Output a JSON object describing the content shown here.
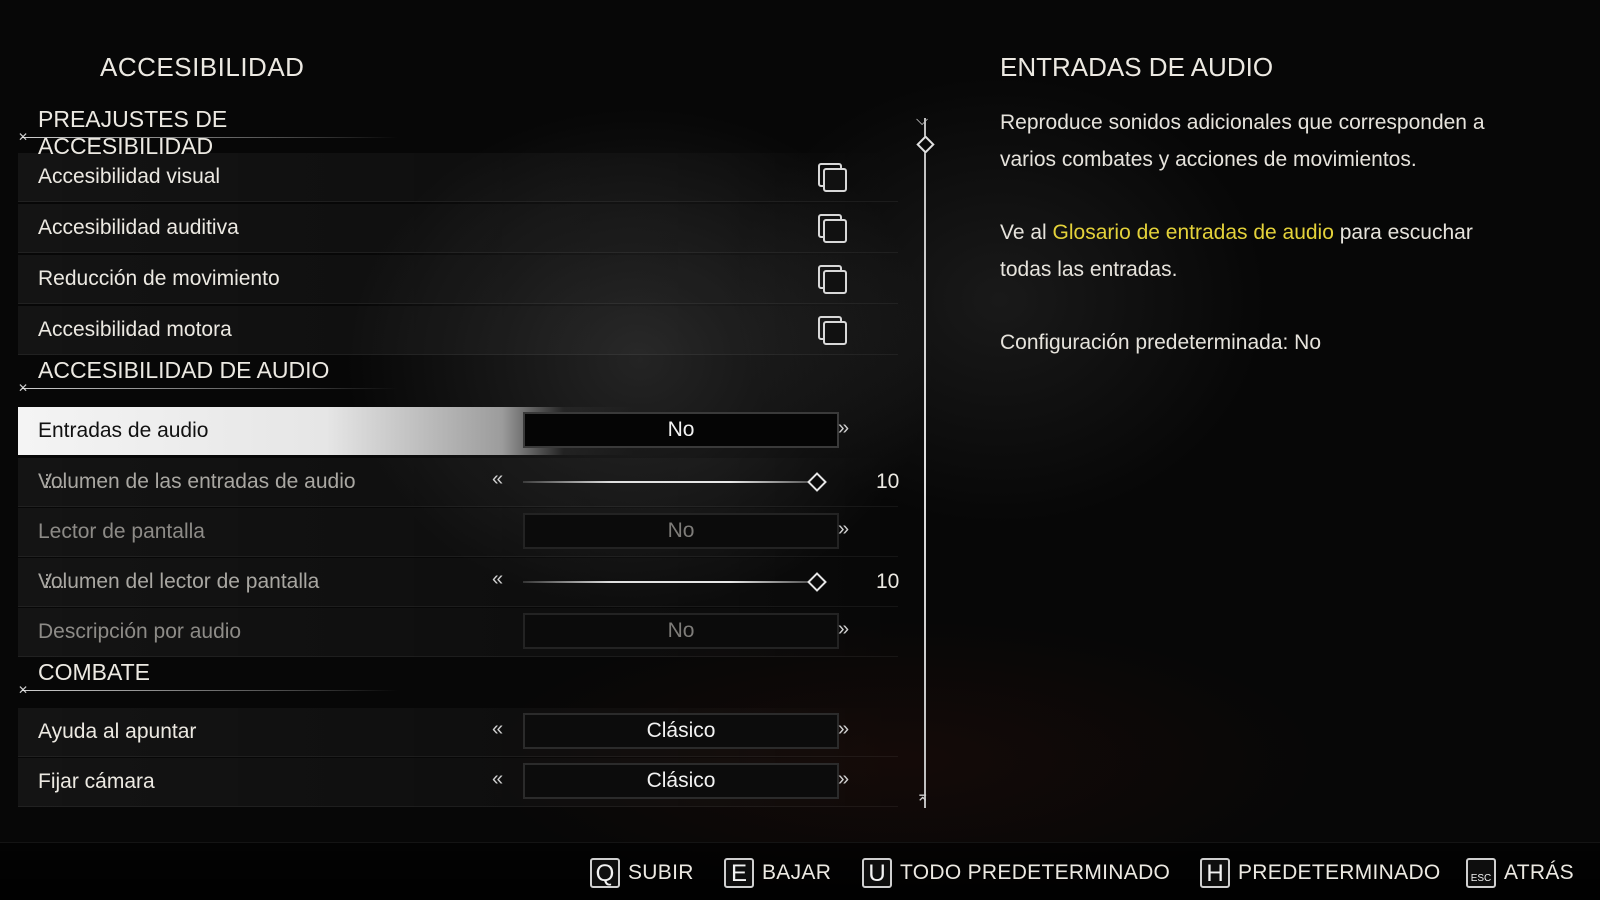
{
  "menu": {
    "title": "ACCESIBILIDAD",
    "sections": {
      "presets": "PREAJUSTES DE ACCESIBILIDAD",
      "audio": "ACCESIBILIDAD DE AUDIO",
      "combat": "COMBATE"
    },
    "presets": [
      {
        "label": "Accesibilidad visual"
      },
      {
        "label": "Accesibilidad auditiva"
      },
      {
        "label": "Reducción de movimiento"
      },
      {
        "label": "Accesibilidad motora"
      }
    ],
    "audio_cues": {
      "label": "Entradas de audio",
      "value": "No",
      "selected": true
    },
    "audio_cues_volume": {
      "label": "Volumen de las entradas de audio",
      "value": "10",
      "level": 1.0
    },
    "screen_reader": {
      "label": "Lector de pantalla",
      "value": "No"
    },
    "screen_reader_volume": {
      "label": "Volumen del lector de pantalla",
      "value": "10",
      "level": 1.0
    },
    "audio_description": {
      "label": "Descripción por audio",
      "value": "No"
    },
    "aim_assist": {
      "label": "Ayuda al apuntar",
      "value": "Clásico"
    },
    "lock_camera": {
      "label": "Fijar cámara",
      "value": "Clásico"
    }
  },
  "info": {
    "title": "ENTRADAS DE AUDIO",
    "description": "Reproduce sonidos adicionales que corresponden a varios combates y acciones de movimientos.",
    "link_prefix": "Ve al ",
    "link_text": "Glosario de entradas de audio",
    "link_suffix": " para escuchar todas las entradas.",
    "default_setting": "Configuración predeterminada: No",
    "link_color": "#e4d23a"
  },
  "footer": {
    "hints": [
      {
        "key": "Q",
        "label": "SUBIR"
      },
      {
        "key": "E",
        "label": "BAJAR"
      },
      {
        "key": "U",
        "label": "TODO PREDETERMINADO"
      },
      {
        "key": "H",
        "label": "PREDETERMINADO"
      },
      {
        "key": "ESC",
        "label": "ATRÁS"
      }
    ]
  }
}
